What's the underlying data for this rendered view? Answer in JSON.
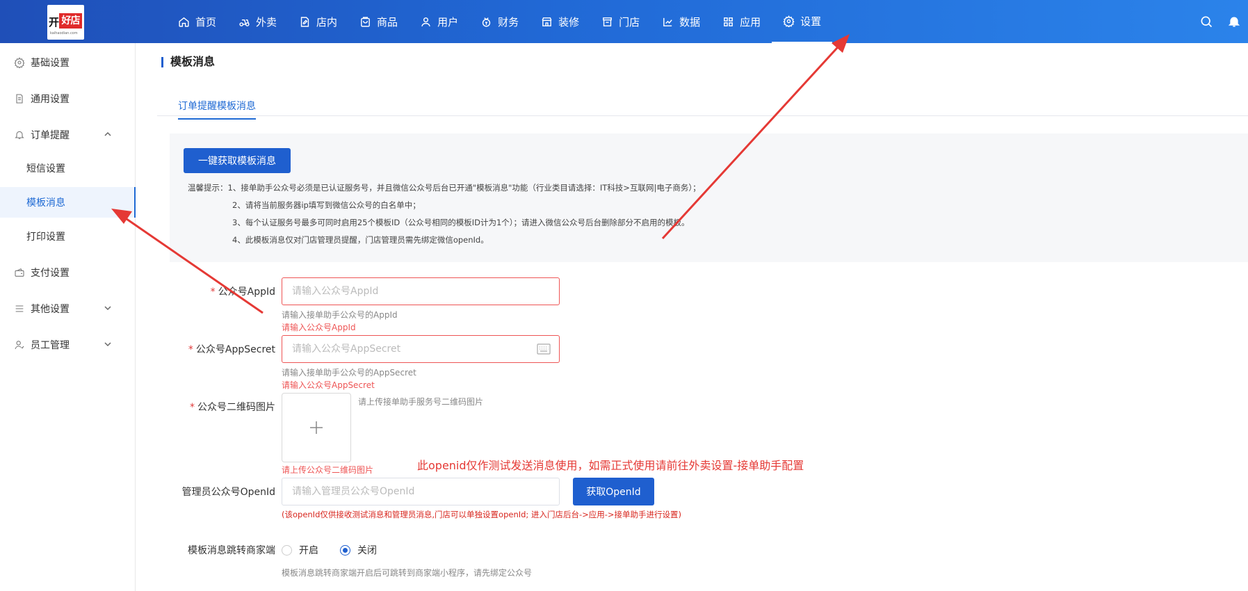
{
  "logo": {
    "part1": "开",
    "part2": "好店",
    "sub": "kaihaodian.com"
  },
  "nav": [
    {
      "label": "首页",
      "icon": "home-icon"
    },
    {
      "label": "外卖",
      "icon": "scooter-icon"
    },
    {
      "label": "店内",
      "icon": "store-edit-icon"
    },
    {
      "label": "商品",
      "icon": "goods-icon"
    },
    {
      "label": "用户",
      "icon": "user-icon"
    },
    {
      "label": "财务",
      "icon": "wallet-icon"
    },
    {
      "label": "装修",
      "icon": "shop-decor-icon"
    },
    {
      "label": "门店",
      "icon": "shop-icon"
    },
    {
      "label": "数据",
      "icon": "chart-icon"
    },
    {
      "label": "应用",
      "icon": "apps-icon"
    },
    {
      "label": "设置",
      "icon": "gear-icon",
      "active": true
    }
  ],
  "sidebar": {
    "items": [
      {
        "label": "基础设置",
        "icon": "gear-icon"
      },
      {
        "label": "通用设置",
        "icon": "document-icon"
      },
      {
        "label": "订单提醒",
        "icon": "bell-icon",
        "expanded": true
      },
      {
        "label": "支付设置",
        "icon": "wallet-icon"
      },
      {
        "label": "其他设置",
        "icon": "list-icon"
      },
      {
        "label": "员工管理",
        "icon": "staff-icon"
      }
    ],
    "sub_items": [
      {
        "label": "短信设置"
      },
      {
        "label": "模板消息",
        "active": true
      },
      {
        "label": "打印设置"
      }
    ]
  },
  "main": {
    "title": "模板消息",
    "tab": "订单提醒模板消息",
    "fetch_button": "一键获取模板消息",
    "tips": [
      "温馨提示：1、接单助手公众号必须是已认证服务号，并且微信公众号后台已开通\"模板消息\"功能（行业类目请选择：IT科技>互联网|电子商务）；",
      "2、请将当前服务器ip填写到微信公众号的白名单中；",
      "3、每个认证服务号最多可同时启用25个模板ID（公众号相同的模板ID计为1个）；请进入微信公众号后台删除部分不启用的模板。",
      "4、此模板消息仅对门店管理员提醒，门店管理员需先绑定微信openId。"
    ],
    "form": {
      "appid": {
        "label": "公众号AppId",
        "placeholder": "请输入公众号AppId",
        "hint": "请输入接单助手公众号的AppId",
        "error": "请输入公众号AppId"
      },
      "appsecret": {
        "label": "公众号AppSecret",
        "placeholder": "请输入公众号AppSecret",
        "hint": "请输入接单助手公众号的AppSecret",
        "error": "请输入公众号AppSecret"
      },
      "qrcode": {
        "label": "公众号二维码图片",
        "hint": "请上传接单助手服务号二维码图片",
        "error": "请上传公众号二维码图片"
      },
      "openid": {
        "label": "管理员公众号OpenId",
        "placeholder": "请输入管理员公众号OpenId",
        "button": "获取OpenId",
        "note": "(该openId仅供接收测试消息和管理员消息,门店可以单独设置openId; 进入门店后台->应用->接单助手进行设置)"
      },
      "jump": {
        "label": "模板消息跳转商家端",
        "option_on": "开启",
        "option_off": "关闭",
        "selected": "关闭",
        "hint": "模板消息跳转商家端开启后可跳转到商家端小程序，请先绑定公众号"
      }
    },
    "annotation": "此openid仅作测试发送消息使用，如需正式使用请前往外卖设置-接单助手配置"
  },
  "colors": {
    "primary": "#1f5fcf",
    "error": "#e55555",
    "annotation": "#e53935"
  }
}
